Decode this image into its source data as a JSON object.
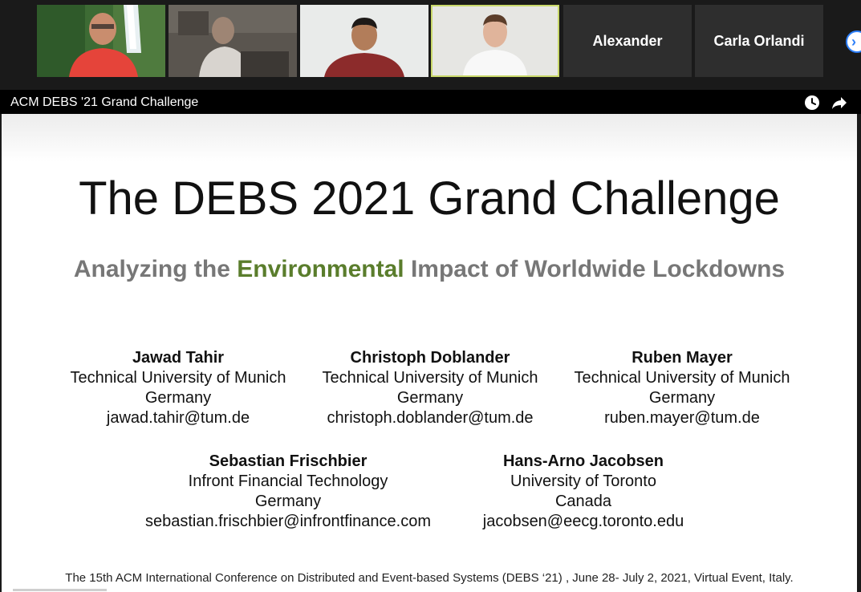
{
  "meeting": {
    "participants": [
      {
        "name": "",
        "has_video": true
      },
      {
        "name": "",
        "has_video": true
      },
      {
        "name": "",
        "has_video": true
      },
      {
        "name": "",
        "has_video": true,
        "active_speaker": true
      },
      {
        "name": "Alexander",
        "has_video": false
      },
      {
        "name": "Carla Orlandi",
        "has_video": false
      }
    ],
    "next_page_icon": "chevron-right-icon",
    "active_speaker_color": "#c9d86a"
  },
  "share": {
    "title": "ACM DEBS '21 Grand Challenge",
    "icons": [
      "clock-icon",
      "share-arrow-icon"
    ]
  },
  "slide": {
    "title": "The DEBS 2021 Grand Challenge",
    "subtitle_before": "Analyzing the",
    "subtitle_highlight": "Environmental",
    "subtitle_after": "Impact of Worldwide Lockdowns",
    "highlight_color": "#5a7d2c",
    "authors": [
      {
        "name": "Jawad Tahir",
        "affiliation": "Technical University of Munich",
        "country": "Germany",
        "email": "jawad.tahir@tum.de"
      },
      {
        "name": "Christoph Doblander",
        "affiliation": "Technical University of Munich",
        "country": "Germany",
        "email": "christoph.doblander@tum.de"
      },
      {
        "name": "Ruben Mayer",
        "affiliation": "Technical University of Munich",
        "country": "Germany",
        "email": "ruben.mayer@tum.de"
      },
      {
        "name": "Sebastian Frischbier",
        "affiliation": "Infront Financial Technology",
        "country": "Germany",
        "email": "sebastian.frischbier@infrontfinance.com"
      },
      {
        "name": "Hans-Arno Jacobsen",
        "affiliation": "University of Toronto",
        "country": "Canada",
        "email": "jacobsen@eecg.toronto.edu"
      }
    ],
    "footer": "The 15th ACM International Conference on Distributed and Event-based Systems (DEBS ‘21) , June 28- July 2, 2021, Virtual Event, Italy."
  }
}
